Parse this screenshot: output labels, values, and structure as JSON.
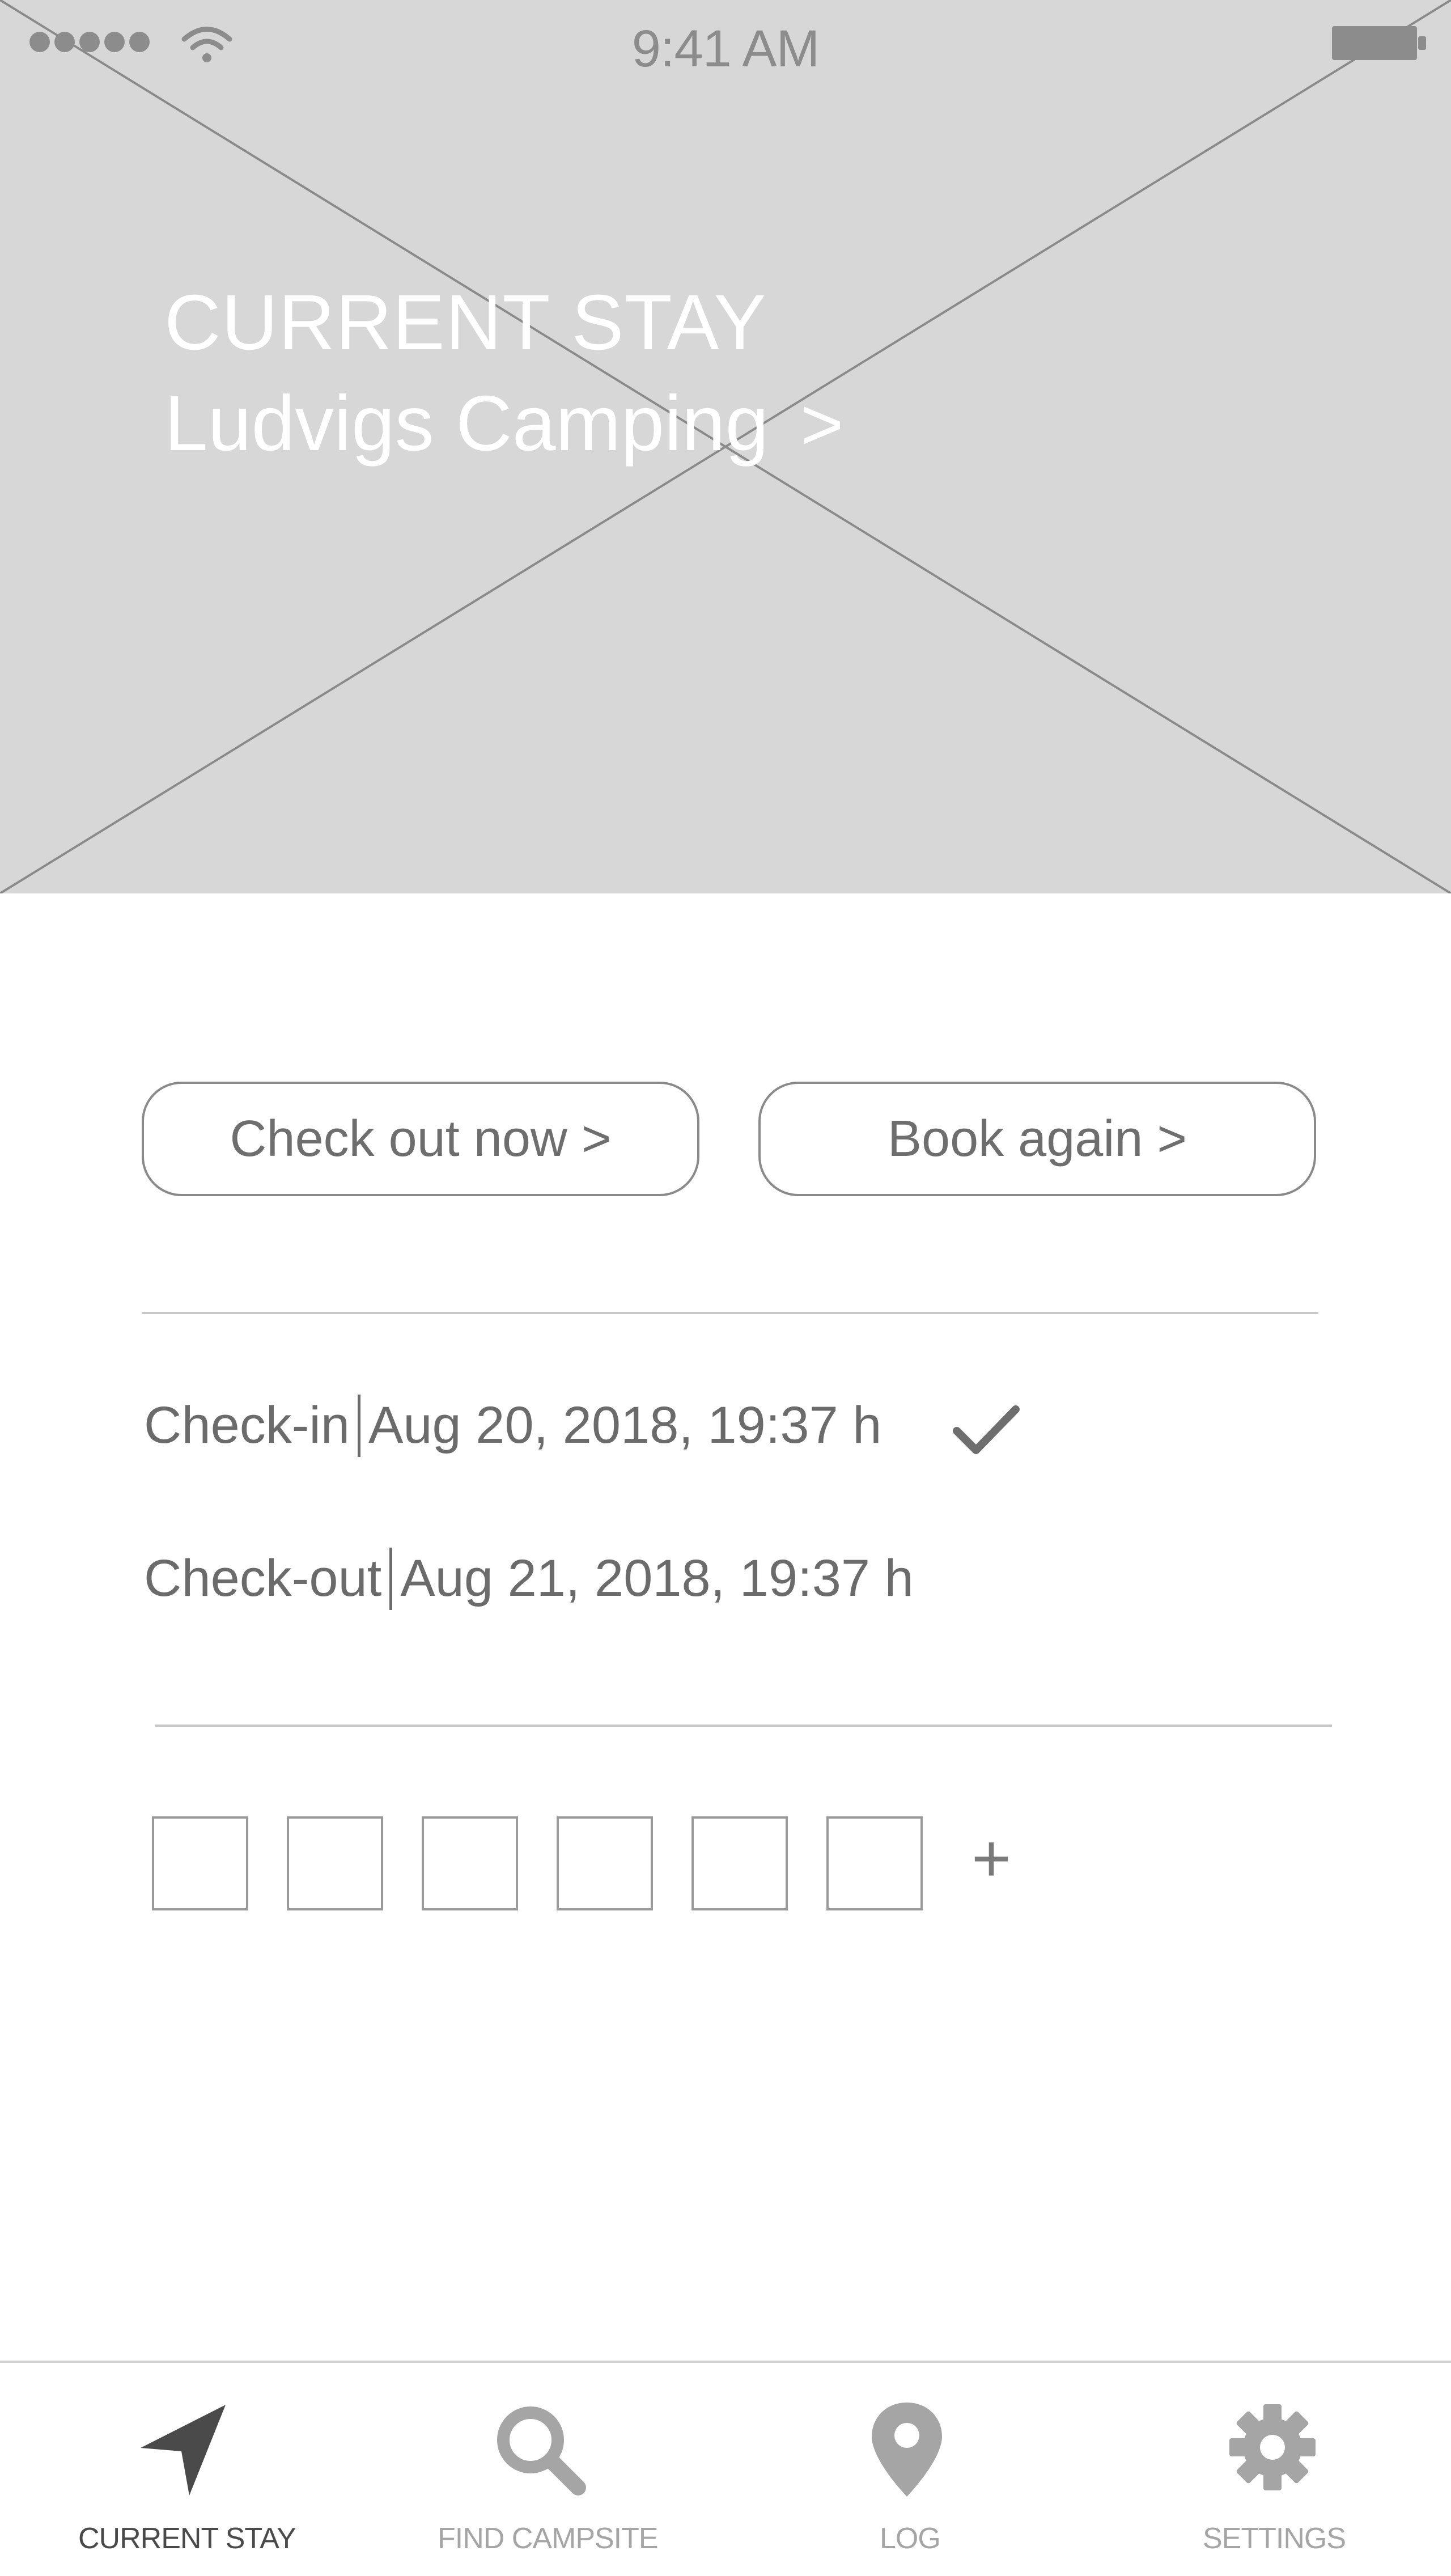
{
  "status_bar": {
    "time": "9:41 AM",
    "signal_icon": "signal-dots-icon",
    "wifi_icon": "wifi-icon",
    "battery_icon": "battery-icon"
  },
  "hero": {
    "heading": "CURRENT STAY",
    "campsite_name": "Ludvigs Camping",
    "chevron": ">",
    "image": "image-placeholder"
  },
  "actions": {
    "checkout_label": "Check out now >",
    "book_again_label": "Book again >"
  },
  "stay": {
    "checkin_label": "Check-in",
    "checkin_value": "Aug 20, 2018, 19:37 h",
    "checkin_done_icon": "checkmark-icon",
    "checkout_label": "Check-out",
    "checkout_value": "Aug 21, 2018, 19:37 h"
  },
  "photos": {
    "count": 6,
    "add_label": "+"
  },
  "tab_bar": {
    "tabs": [
      {
        "label": "CURRENT STAY",
        "icon": "navigation-arrow-icon",
        "active": true
      },
      {
        "label": "FIND CAMPSITE",
        "icon": "search-icon",
        "active": false
      },
      {
        "label": "LOG",
        "icon": "map-pin-icon",
        "active": false
      },
      {
        "label": "SETTINGS",
        "icon": "gear-icon",
        "active": false
      }
    ]
  },
  "colors": {
    "placeholder_bg": "#d7d7d7",
    "text_gray": "#6b6b6b",
    "active_tab": "#4a4a4a",
    "inactive_tab": "#a5a5a5"
  }
}
